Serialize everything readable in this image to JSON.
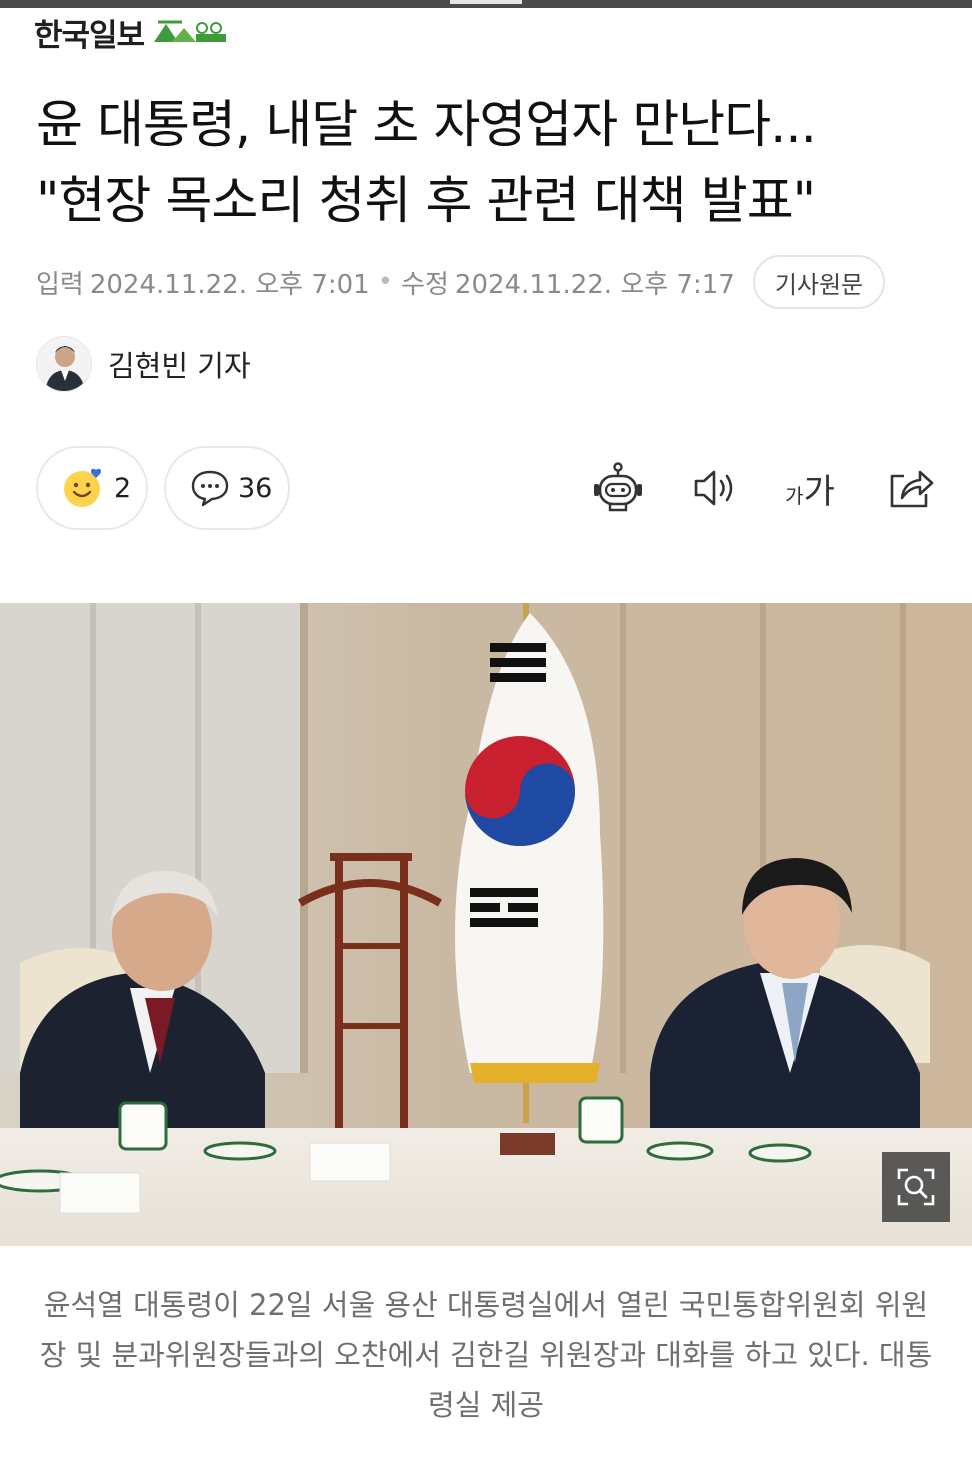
{
  "brand": {
    "name": "한국일보"
  },
  "article": {
    "title_line1": "윤 대통령, 내달 초 자영업자 만난다...",
    "title_line2": "\"현장 목소리 청취 후 관련 대책 발표\"",
    "input_label": "입력",
    "input_time": "2024.11.22. 오후 7:01",
    "modified_label": "수정",
    "modified_time": "2024.11.22. 오후 7:17",
    "original_button": "기사원문",
    "author": "김현빈 기자",
    "caption": "윤석열 대통령이 22일 서울 용산 대통령실에서 열린 국민통합위원회 위원장 및 분과위원장들과의 오찬에서 김한길 위원장과 대화를 하고 있다. 대통령실 제공"
  },
  "actions": {
    "reaction_count": "2",
    "comment_count": "36",
    "font_size_label_small": "가",
    "font_size_label_large": "가"
  },
  "icons": [
    "emoji-reaction-icon",
    "comment-icon",
    "robot-summary-icon",
    "speaker-icon",
    "font-size-icon",
    "share-icon",
    "zoom-icon"
  ],
  "colors": {
    "brand_green": "#3f9b3a",
    "text_gray": "#8a8a8a",
    "border": "#e6e6e6"
  }
}
